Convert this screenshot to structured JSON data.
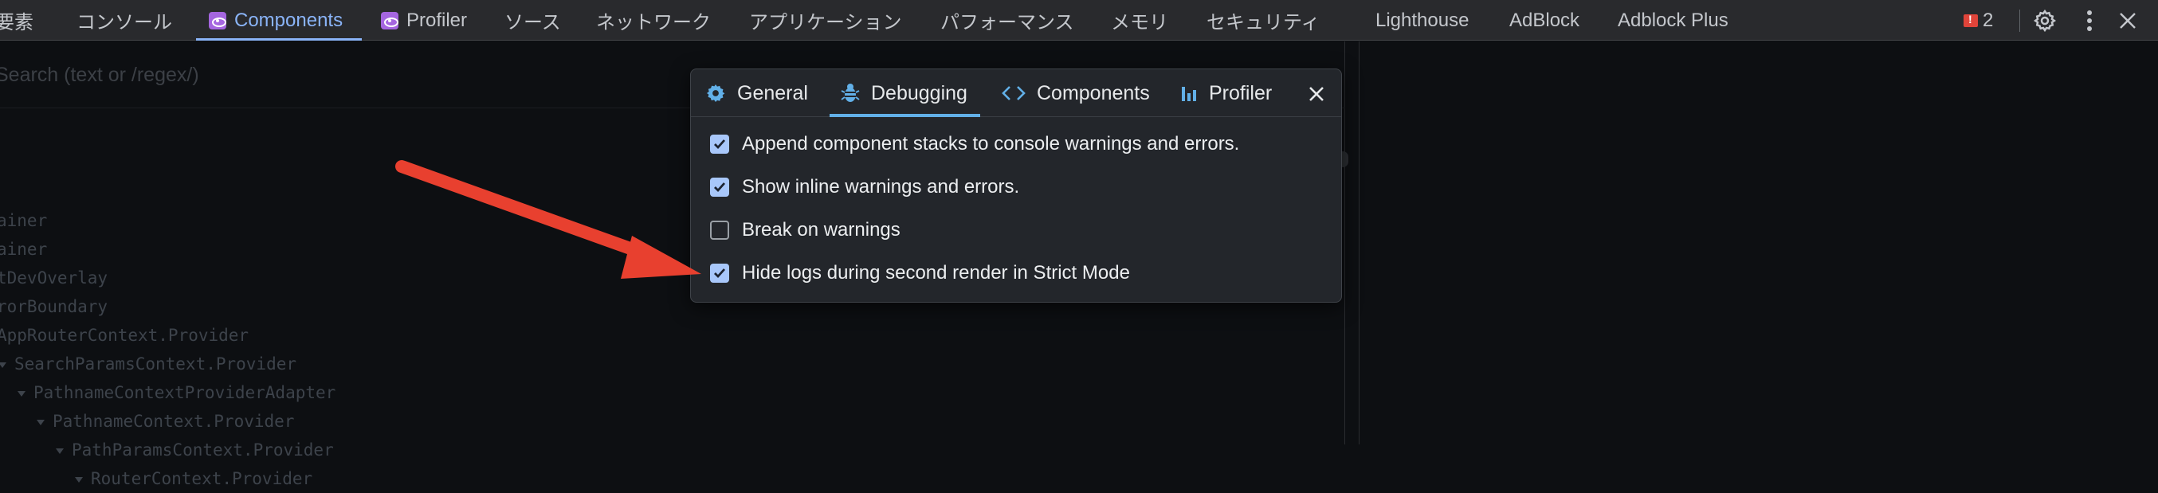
{
  "devtools": {
    "tabs": [
      {
        "label": "要素"
      },
      {
        "label": "コンソール"
      },
      {
        "label": "Components",
        "icon": "react-icon",
        "active": true
      },
      {
        "label": "Profiler",
        "icon": "react-icon"
      },
      {
        "label": "ソース"
      },
      {
        "label": "ネットワーク"
      },
      {
        "label": "アプリケーション"
      },
      {
        "label": "パフォーマンス"
      },
      {
        "label": "メモリ"
      },
      {
        "label": "セキュリティ"
      },
      {
        "label": "Lighthouse"
      },
      {
        "label": "AdBlock"
      },
      {
        "label": "Adblock Plus"
      }
    ],
    "issues_count": "2",
    "accent_color": "#8ab4f8"
  },
  "components_panel": {
    "search_placeholder": "Search (text or /regex/)",
    "tree": [
      "ainer",
      "ainer",
      "tDevOverlay",
      "rorBoundary",
      "AppRouterContext.Provider",
      "SearchParamsContext.Provider",
      "PathnameContextProviderAdapter",
      "PathnameContext.Provider",
      "PathParamsContext.Provider",
      "RouterContext.Provider"
    ]
  },
  "settings_modal": {
    "tabs": [
      {
        "label": "General",
        "icon": "gear-icon"
      },
      {
        "label": "Debugging",
        "icon": "bug-icon",
        "active": true
      },
      {
        "label": "Components",
        "icon": "code-icon"
      },
      {
        "label": "Profiler",
        "icon": "bar-chart-icon"
      }
    ],
    "options": [
      {
        "label": "Append component stacks to console warnings and errors.",
        "checked": true
      },
      {
        "label": "Show inline warnings and errors.",
        "checked": true
      },
      {
        "label": "Break on warnings",
        "checked": false
      },
      {
        "label": "Hide logs during second render in Strict Mode",
        "checked": true
      }
    ],
    "tab_underline_color": "#62b0e8",
    "checkbox_color": "#a8c7fa"
  },
  "annotation": {
    "arrow_color": "#e8402f"
  }
}
